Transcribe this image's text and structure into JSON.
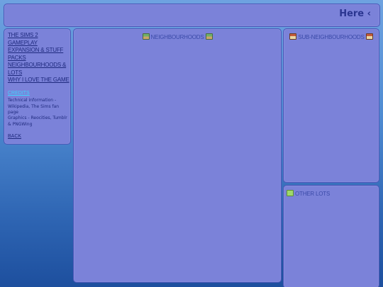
{
  "header": {
    "title": "Here ‹"
  },
  "sidebar": {
    "nav_items": [
      "THE SIMS 2",
      "GAMEPLAY",
      "EXPANSION & STUFF PACKS",
      "NEIGHBOURHOODS & LOTS",
      "WHY I LOVE THE GAME"
    ],
    "credits_title": "CREDITS",
    "credits": [
      "Technical information - Wikipedia, The Sims fan page",
      "Graphics - Reocities, Tumblr & PNGWing"
    ],
    "back_label": "BACK"
  },
  "main_panel": {
    "heading": "NEIGHBOURHOODS",
    "left_icon": "neighbourhood-icon",
    "right_icon": "neighbourhood-icon"
  },
  "sub_panel": {
    "heading": "SUB-NEIGHBOURHOODS",
    "left_icon": "house-icon",
    "right_icon": "house-icon"
  },
  "other_panel": {
    "heading": "OTHER LOTS",
    "icon": "lot-icon"
  },
  "colors": {
    "panel_fill": "#7b82d9",
    "panel_border": "#4a58b8",
    "link_text": "#1f2a7e",
    "credits_accent": "#3fd6ff",
    "heading_text": "#3a4aa8"
  }
}
